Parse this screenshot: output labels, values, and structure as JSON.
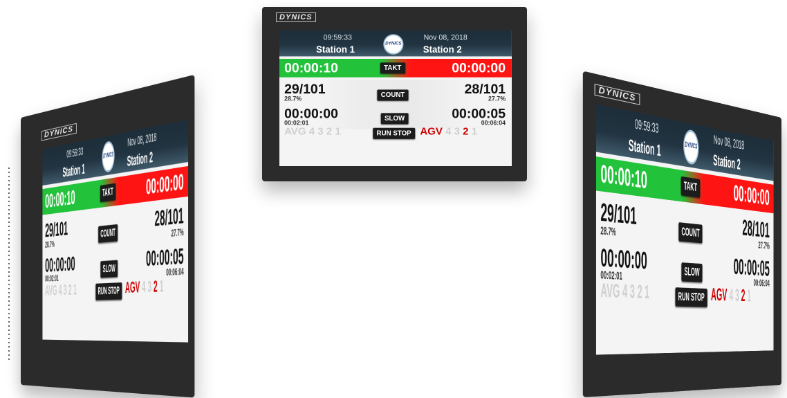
{
  "brand": "DYNICS",
  "header": {
    "time": "09:59:33",
    "date": "Nov 08, 2018",
    "station1": "Station 1",
    "station2": "Station 2",
    "logo_text": "DYNICS"
  },
  "takt": {
    "left": "00:00:10",
    "label": "TAKT",
    "right": "00:00:00"
  },
  "count": {
    "left": "29/101",
    "left_pct": "28.7%",
    "label": "COUNT",
    "right": "28/101",
    "right_pct": "27.7%"
  },
  "slow": {
    "left": "00:00:00",
    "left_sub": "00:02:01",
    "label": "SLOW",
    "right": "00:00:05",
    "right_sub": "00:06:04"
  },
  "avg": {
    "label": "AVG",
    "digits": [
      "4",
      "3",
      "2",
      "1"
    ]
  },
  "run_stop": "RUN STOP",
  "agv": {
    "label": "AGV",
    "digits": [
      "4",
      "3",
      "2",
      "1"
    ]
  },
  "colors": {
    "green": "#22c33a",
    "red": "#ff1414",
    "bezel": "#2b2b2b",
    "header": "#223341"
  }
}
